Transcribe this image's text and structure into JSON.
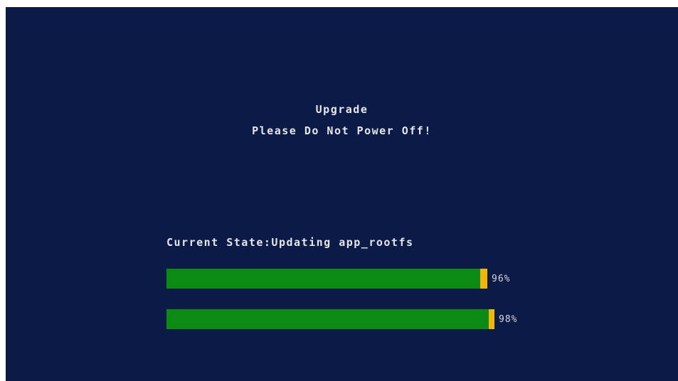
{
  "header": {
    "title": "Upgrade",
    "warning": "Please Do Not Power Off!"
  },
  "status": {
    "current_state": "Current State:Updating app_rootfs"
  },
  "progress_bars": [
    {
      "value": 0.96,
      "label": "96%"
    },
    {
      "value": 0.98,
      "label": "98%"
    }
  ],
  "colors": {
    "background": "#0c1a48",
    "bar_fill": "#0b8a14",
    "bar_cap": "#f2b60a",
    "text": "#e6e6e6"
  }
}
